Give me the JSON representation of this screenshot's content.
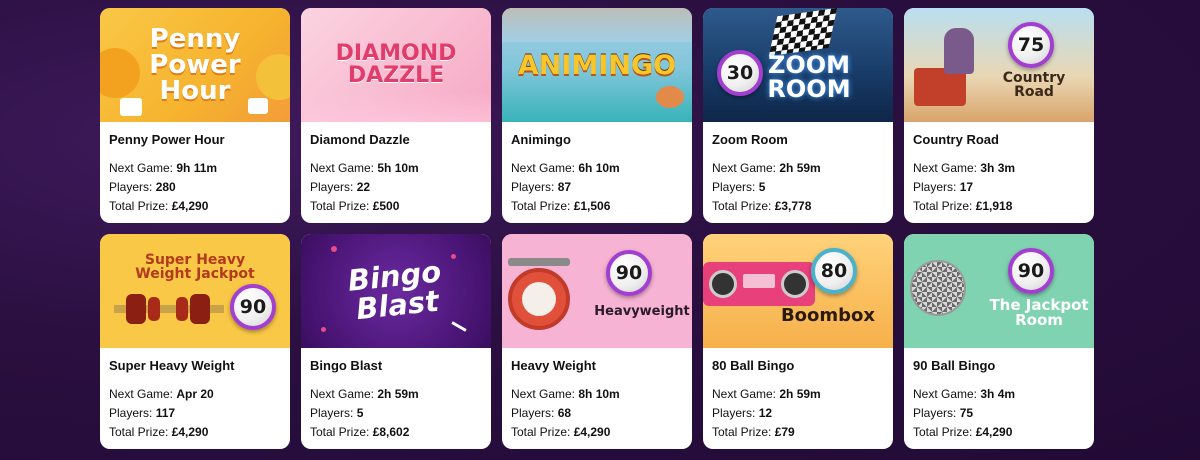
{
  "games": [
    {
      "key": "penny",
      "art_text": "Penny Power Hour",
      "name": "Penny Power Hour",
      "next_label": "Next Game:",
      "next": "9h 11m",
      "players_label": "Players:",
      "players": "280",
      "prize_label": "Total Prize:",
      "prize": "£4,290"
    },
    {
      "key": "diamond",
      "art_text": "DIAMOND DAZZLE",
      "name": "Diamond Dazzle",
      "next_label": "Next Game:",
      "next": "5h 10m",
      "players_label": "Players:",
      "players": "22",
      "prize_label": "Total Prize:",
      "prize": "£500"
    },
    {
      "key": "animingo",
      "art_text": "ANIMINGO",
      "name": "Animingo",
      "next_label": "Next Game:",
      "next": "6h 10m",
      "players_label": "Players:",
      "players": "87",
      "prize_label": "Total Prize:",
      "prize": "£1,506"
    },
    {
      "key": "zoom",
      "art_text": "ZOOM ROOM",
      "ball": "30",
      "name": "Zoom Room",
      "next_label": "Next Game:",
      "next": "2h 59m",
      "players_label": "Players:",
      "players": "5",
      "prize_label": "Total Prize:",
      "prize": "£3,778"
    },
    {
      "key": "country",
      "art_text": "Country Road",
      "ball": "75",
      "name": "Country Road",
      "next_label": "Next Game:",
      "next": "3h 3m",
      "players_label": "Players:",
      "players": "17",
      "prize_label": "Total Prize:",
      "prize": "£1,918"
    },
    {
      "key": "heavy",
      "art_text": "Super Heavy Weight Jackpot",
      "ball": "90",
      "name": "Super Heavy Weight",
      "next_label": "Next Game:",
      "next": "Apr 20",
      "players_label": "Players:",
      "players": "117",
      "prize_label": "Total Prize:",
      "prize": "£4,290"
    },
    {
      "key": "blast",
      "art_text": "Bingo Blast",
      "name": "Bingo Blast",
      "next_label": "Next Game:",
      "next": "2h 59m",
      "players_label": "Players:",
      "players": "5",
      "prize_label": "Total Prize:",
      "prize": "£8,602"
    },
    {
      "key": "hw",
      "art_text": "Heavyweight",
      "ball": "90",
      "name": "Heavy Weight",
      "next_label": "Next Game:",
      "next": "8h 10m",
      "players_label": "Players:",
      "players": "68",
      "prize_label": "Total Prize:",
      "prize": "£4,290"
    },
    {
      "key": "boom",
      "art_text": "Boombox",
      "ball": "80",
      "name": "80 Ball Bingo",
      "next_label": "Next Game:",
      "next": "2h 59m",
      "players_label": "Players:",
      "players": "12",
      "prize_label": "Total Prize:",
      "prize": "£79"
    },
    {
      "key": "jack",
      "art_text": "The Jackpot Room",
      "ball": "90",
      "name": "90 Ball Bingo",
      "next_label": "Next Game:",
      "next": "3h 4m",
      "players_label": "Players:",
      "players": "75",
      "prize_label": "Total Prize:",
      "prize": "£4,290"
    }
  ]
}
